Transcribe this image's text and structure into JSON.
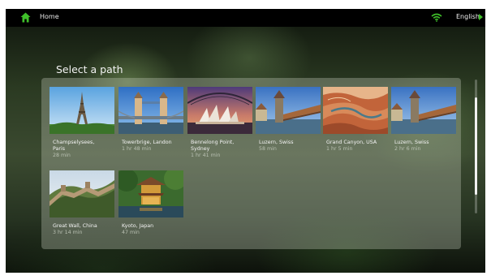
{
  "topbar": {
    "home_label": "Home",
    "language_label": "English",
    "icons": [
      "home-icon",
      "wifi-icon",
      "arrow-right-icon"
    ],
    "accent_color": "#3fbf2a"
  },
  "heading": "Select a path",
  "paths": [
    {
      "title": "Champselysees,\nParis",
      "duration": "28 min",
      "image": "eiffel-tower"
    },
    {
      "title": "Towerbrige, Landon",
      "duration": "1 hr 48 min",
      "image": "tower-bridge"
    },
    {
      "title": "Bennelong Point,\nSydney",
      "duration": "1 hr 41 min",
      "image": "sydney-opera-house"
    },
    {
      "title": "Luzern, Swiss",
      "duration": "58 min",
      "image": "chapel-bridge"
    },
    {
      "title": "Grand Canyon, USA",
      "duration": "1 hr 5 min",
      "image": "grand-canyon"
    },
    {
      "title": "Luzern, Swiss",
      "duration": "2 hr 6 min",
      "image": "chapel-bridge"
    },
    {
      "title": "Great Wall, China",
      "duration": "3 hr 14 min",
      "image": "great-wall"
    },
    {
      "title": "Kyoto, Japan",
      "duration": "47 min",
      "image": "pagoda"
    }
  ]
}
